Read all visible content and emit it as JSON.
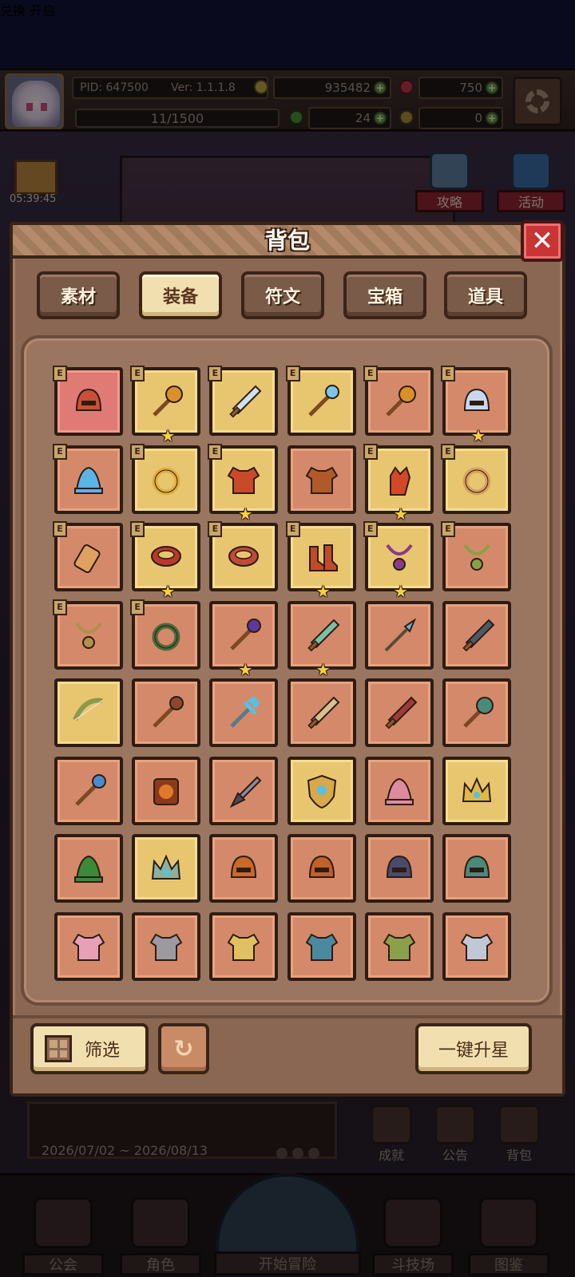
{
  "hud": {
    "pid": "PID: 647500",
    "version": "Ver: 1.1.1.8",
    "gold": "935482",
    "gems": "750",
    "xp": "11/1500",
    "clover": "24",
    "keys": "0"
  },
  "scene": {
    "gift_timer": "05:39:45",
    "sign_text": "兑换 开启",
    "side_buttons": [
      "攻略",
      "活动"
    ],
    "event_date": "2026/07/02 ~ 2026/08/13",
    "mini_buttons": [
      "成就",
      "公告",
      "背包"
    ],
    "nav": [
      "公会",
      "角色",
      "开始冒险",
      "斗技场",
      "图鉴"
    ]
  },
  "panel": {
    "title": "背包",
    "close_symbol": "✕",
    "tabs": [
      "素材",
      "装备",
      "符文",
      "宝箱",
      "道具"
    ],
    "active_tab": 1,
    "eq_badge": "E",
    "star_symbol": "★",
    "filter_label": "筛选",
    "refresh_symbol": "↻",
    "upgrade_label": "一键升星",
    "items": [
      {
        "icon": "helmet-icon",
        "bg": "red",
        "eq": true,
        "star": false,
        "color": "#c9503a"
      },
      {
        "icon": "mace-icon",
        "bg": "gold",
        "eq": true,
        "star": true,
        "color": "#d9902a"
      },
      {
        "icon": "sword-icon",
        "bg": "gold",
        "eq": true,
        "star": false,
        "color": "#cfe0f0"
      },
      {
        "icon": "staff-icon",
        "bg": "gold",
        "eq": true,
        "star": false,
        "color": "#7ac8e8"
      },
      {
        "icon": "mace-icon",
        "bg": "orange",
        "eq": true,
        "star": false,
        "color": "#d9902a"
      },
      {
        "icon": "helmet-icon",
        "bg": "orange",
        "eq": true,
        "star": true,
        "color": "#c8d8f0"
      },
      {
        "icon": "hat-icon",
        "bg": "orange",
        "eq": true,
        "star": false,
        "color": "#5ab4e8"
      },
      {
        "icon": "ring-icon",
        "bg": "gold",
        "eq": true,
        "star": false,
        "color": "#e0b040"
      },
      {
        "icon": "armor-icon",
        "bg": "gold",
        "eq": true,
        "star": true,
        "color": "#c84a2a"
      },
      {
        "icon": "armor-icon",
        "bg": "orange",
        "eq": false,
        "star": false,
        "color": "#b05a2a"
      },
      {
        "icon": "glove-icon",
        "bg": "gold",
        "eq": true,
        "star": true,
        "color": "#d04a2a"
      },
      {
        "icon": "ring-icon",
        "bg": "gold",
        "eq": true,
        "star": false,
        "color": "#d8a060"
      },
      {
        "icon": "bracer-icon",
        "bg": "orange",
        "eq": true,
        "star": false,
        "color": "#e0a060"
      },
      {
        "icon": "belt-icon",
        "bg": "gold",
        "eq": true,
        "star": true,
        "color": "#b83a2a"
      },
      {
        "icon": "belt-icon",
        "bg": "gold",
        "eq": true,
        "star": false,
        "color": "#c04a3a"
      },
      {
        "icon": "boots-icon",
        "bg": "gold",
        "eq": true,
        "star": true,
        "color": "#c04a2a"
      },
      {
        "icon": "necklace-icon",
        "bg": "gold",
        "eq": true,
        "star": true,
        "color": "#8a3a8a"
      },
      {
        "icon": "necklace-icon",
        "bg": "orange",
        "eq": true,
        "star": false,
        "color": "#8aa048"
      },
      {
        "icon": "necklace-icon",
        "bg": "orange",
        "eq": true,
        "star": false,
        "color": "#b0904a"
      },
      {
        "icon": "ring-icon",
        "bg": "orange",
        "eq": true,
        "star": false,
        "color": "#4a6a3a"
      },
      {
        "icon": "staff-icon",
        "bg": "orange",
        "eq": false,
        "star": true,
        "color": "#5a3a9a"
      },
      {
        "icon": "sword-icon",
        "bg": "orange",
        "eq": false,
        "star": true,
        "color": "#7ac0a8"
      },
      {
        "icon": "spear-icon",
        "bg": "orange",
        "eq": false,
        "star": false,
        "color": "#6ab0d0"
      },
      {
        "icon": "sword-icon",
        "bg": "orange",
        "eq": false,
        "star": false,
        "color": "#4a5a6a"
      },
      {
        "icon": "bow-icon",
        "bg": "gold",
        "eq": false,
        "star": false,
        "color": "#8a9a4a"
      },
      {
        "icon": "staff-icon",
        "bg": "orange",
        "eq": false,
        "star": false,
        "color": "#8a4a2a"
      },
      {
        "icon": "trident-icon",
        "bg": "orange",
        "eq": false,
        "star": false,
        "color": "#5ac0e0"
      },
      {
        "icon": "sword-icon",
        "bg": "orange",
        "eq": false,
        "star": false,
        "color": "#d8c090"
      },
      {
        "icon": "sword-icon",
        "bg": "orange",
        "eq": false,
        "star": false,
        "color": "#a03a3a"
      },
      {
        "icon": "mace-icon",
        "bg": "orange",
        "eq": false,
        "star": false,
        "color": "#4a8a7a"
      },
      {
        "icon": "staff-icon",
        "bg": "orange",
        "eq": false,
        "star": false,
        "color": "#4a8ad0"
      },
      {
        "icon": "lantern-icon",
        "bg": "orange",
        "eq": false,
        "star": false,
        "color": "#e07a2a"
      },
      {
        "icon": "dagger-icon",
        "bg": "orange",
        "eq": false,
        "star": false,
        "color": "#8a8aa0"
      },
      {
        "icon": "shield-icon",
        "bg": "gold",
        "eq": false,
        "star": false,
        "color": "#d8a84a"
      },
      {
        "icon": "hat-icon",
        "bg": "orange",
        "eq": false,
        "star": false,
        "color": "#e08aa0"
      },
      {
        "icon": "crown-icon",
        "bg": "gold",
        "eq": false,
        "star": false,
        "color": "#e0b84a"
      },
      {
        "icon": "hat-icon",
        "bg": "orange",
        "eq": false,
        "star": false,
        "color": "#3a8a3a"
      },
      {
        "icon": "crown-icon",
        "bg": "gold",
        "eq": false,
        "star": false,
        "color": "#8ab0a0"
      },
      {
        "icon": "helmet-icon",
        "bg": "orange",
        "eq": false,
        "star": false,
        "color": "#c86a2a"
      },
      {
        "icon": "helmet-icon",
        "bg": "orange",
        "eq": false,
        "star": false,
        "color": "#c0602a"
      },
      {
        "icon": "helmet-icon",
        "bg": "orange",
        "eq": false,
        "star": false,
        "color": "#4a4a6a"
      },
      {
        "icon": "helmet-icon",
        "bg": "orange",
        "eq": false,
        "star": false,
        "color": "#4a8a7a"
      },
      {
        "icon": "armor-icon",
        "bg": "orange",
        "eq": false,
        "star": false,
        "color": "#e8a0b8"
      },
      {
        "icon": "armor-icon",
        "bg": "orange",
        "eq": false,
        "star": false,
        "color": "#9a9aa0"
      },
      {
        "icon": "armor-icon",
        "bg": "orange",
        "eq": false,
        "star": false,
        "color": "#e0c060"
      },
      {
        "icon": "armor-icon",
        "bg": "orange",
        "eq": false,
        "star": false,
        "color": "#4a8aa0"
      },
      {
        "icon": "armor-icon",
        "bg": "orange",
        "eq": false,
        "star": false,
        "color": "#8aa04a"
      },
      {
        "icon": "armor-icon",
        "bg": "orange",
        "eq": false,
        "star": false,
        "color": "#c0c8d8"
      }
    ]
  }
}
